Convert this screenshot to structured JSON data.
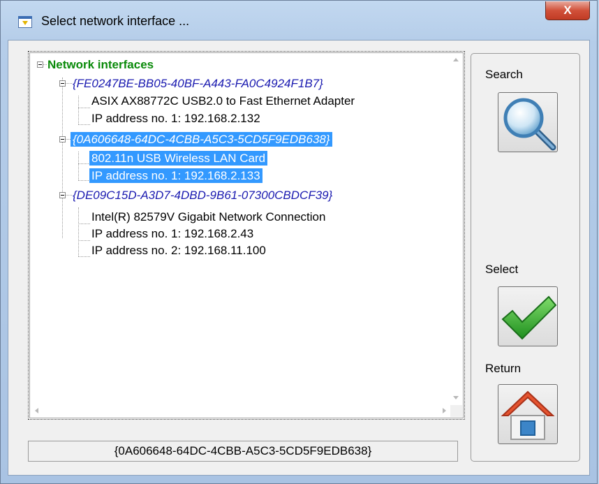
{
  "window": {
    "title": "Select network interface ...",
    "close_label": "X"
  },
  "tree": {
    "root": "Network interfaces",
    "interfaces": [
      {
        "guid": "{FE0247BE-BB05-40BF-A443-FA0C4924F1B7}",
        "children": [
          "ASIX AX88772C USB2.0 to Fast Ethernet Adapter",
          "IP address no. 1: 192.168.2.132"
        ]
      },
      {
        "guid": "{0A606648-64DC-4CBB-A5C3-5CD5F9EDB638}",
        "children": [
          "802.11n USB Wireless LAN Card",
          "IP address no. 1: 192.168.2.133"
        ]
      },
      {
        "guid": "{DE09C15D-A3D7-4DBD-9B61-07300CBDCF39}",
        "children": [
          "Intel(R) 82579V Gigabit Network Connection",
          "IP address no. 1: 192.168.2.43",
          "IP address no. 2: 192.168.11.100"
        ]
      }
    ],
    "selected_interface_index": 1
  },
  "status": {
    "selected_guid": "{0A606648-64DC-4CBB-A5C3-5CD5F9EDB638}"
  },
  "actions": {
    "search_label": "Search",
    "select_label": "Select",
    "return_label": "Return"
  },
  "icons": {
    "search": "magnifier-icon",
    "select": "checkmark-icon",
    "return": "home-icon"
  },
  "colors": {
    "root_text": "#0a8a0a",
    "guid_text": "#1a1ab0",
    "selection": "#3399ff",
    "close_button": "#c13b24"
  }
}
